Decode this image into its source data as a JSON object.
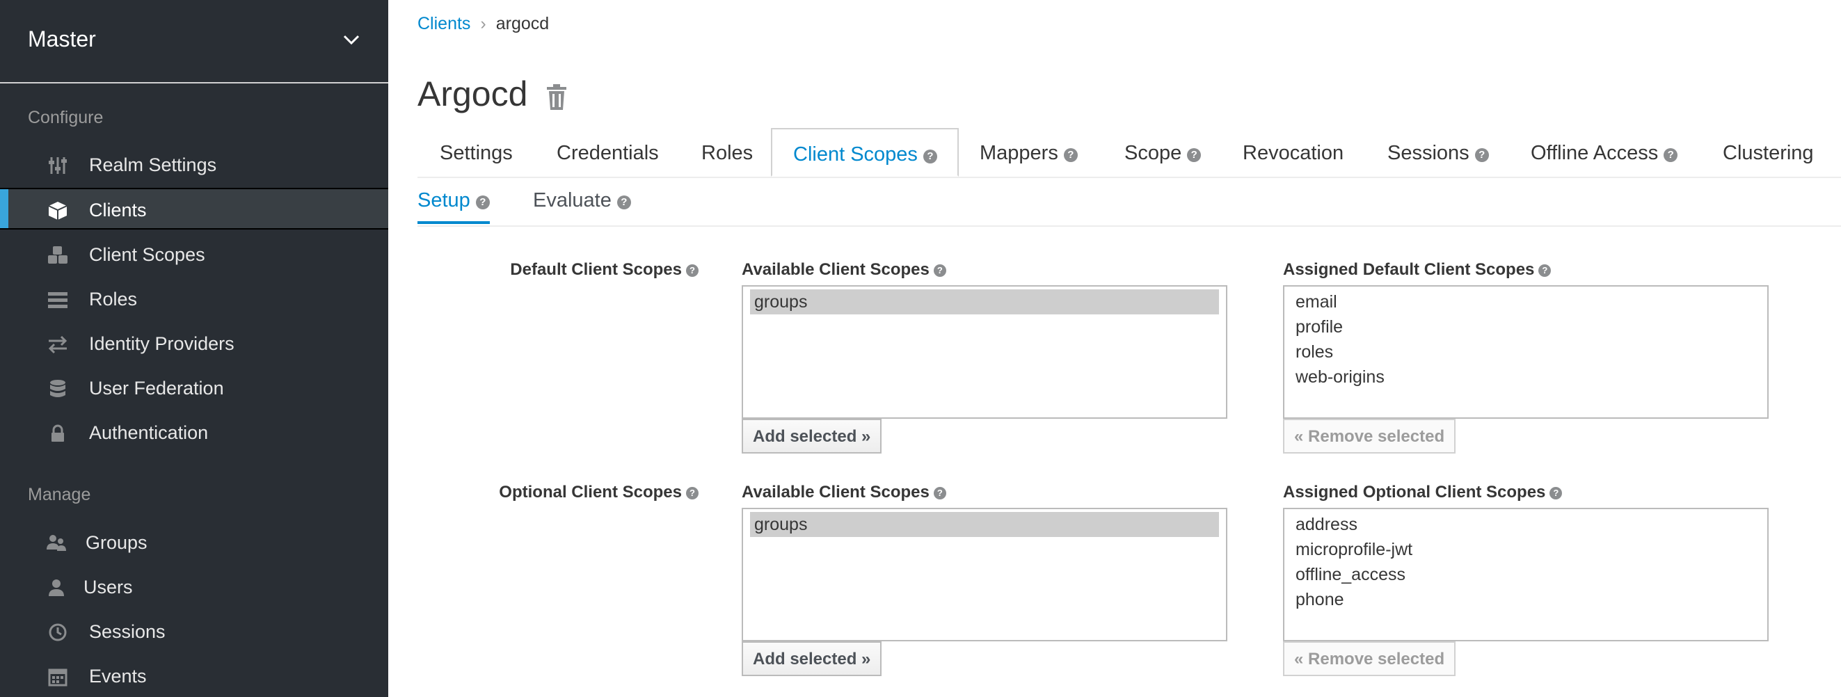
{
  "sidebar": {
    "realm": "Master",
    "configure_label": "Configure",
    "manage_label": "Manage",
    "configure_items": [
      {
        "label": "Realm Settings",
        "icon": "sliders-icon"
      },
      {
        "label": "Clients",
        "icon": "cube-icon",
        "active": true
      },
      {
        "label": "Client Scopes",
        "icon": "cubes-icon"
      },
      {
        "label": "Roles",
        "icon": "roles-list-icon"
      },
      {
        "label": "Identity Providers",
        "icon": "exchange-icon"
      },
      {
        "label": "User Federation",
        "icon": "database-icon"
      },
      {
        "label": "Authentication",
        "icon": "lock-icon"
      }
    ],
    "manage_items": [
      {
        "label": "Groups",
        "icon": "users-group-icon"
      },
      {
        "label": "Users",
        "icon": "user-icon"
      },
      {
        "label": "Sessions",
        "icon": "clock-icon"
      },
      {
        "label": "Events",
        "icon": "calendar-icon"
      }
    ]
  },
  "breadcrumb": {
    "parent": "Clients",
    "separator": "›",
    "current": "argocd"
  },
  "page": {
    "title": "Argocd"
  },
  "tabs": [
    {
      "label": "Settings"
    },
    {
      "label": "Credentials"
    },
    {
      "label": "Roles"
    },
    {
      "label": "Client Scopes",
      "active": true
    },
    {
      "label": "Mappers"
    },
    {
      "label": "Scope"
    },
    {
      "label": "Revocation"
    },
    {
      "label": "Sessions"
    },
    {
      "label": "Offline Access"
    },
    {
      "label": "Clustering"
    }
  ],
  "subtabs": [
    {
      "label": "Setup",
      "active": true
    },
    {
      "label": "Evaluate"
    }
  ],
  "help_glyph": "?",
  "default_scopes": {
    "label": "Default Client Scopes",
    "available_label": "Available Client Scopes",
    "available": [
      "groups"
    ],
    "assigned_label": "Assigned Default Client Scopes",
    "assigned": [
      "email",
      "profile",
      "roles",
      "web-origins"
    ],
    "add_button": "Add selected »",
    "remove_button": "« Remove selected"
  },
  "optional_scopes": {
    "label": "Optional Client Scopes",
    "available_label": "Available Client Scopes",
    "available": [
      "groups"
    ],
    "assigned_label": "Assigned Optional Client Scopes",
    "assigned": [
      "address",
      "microprofile-jwt",
      "offline_access",
      "phone"
    ],
    "add_button": "Add selected »",
    "remove_button": "« Remove selected"
  },
  "colors": {
    "sidebar_bg": "#292e34",
    "accent": "#0088ce",
    "active_bar": "#39a5dc"
  }
}
